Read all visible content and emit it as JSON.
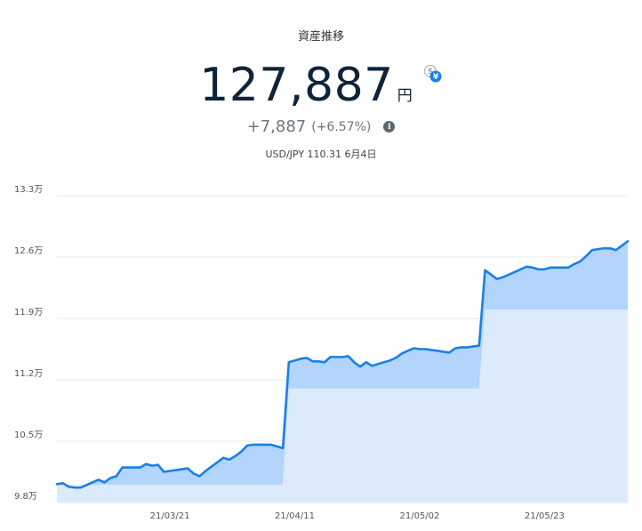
{
  "header": {
    "title": "資産推移",
    "total_value": "127,887",
    "unit": "円",
    "change_abs": "+7,887",
    "change_pct": "(+6.57%)",
    "fx_rate": "USD/JPY 110.31 6月4日"
  },
  "icons": {
    "currency_toggle": "dollar-yen-toggle-icon",
    "info": "info-icon"
  },
  "colors": {
    "line": "#1a7fe8",
    "area_top": "#b3d5fb",
    "area_base": "#dcebfb",
    "grid": "#e8e8e8"
  },
  "chart_data": {
    "type": "area",
    "title": "資産推移",
    "xlabel": "",
    "ylabel": "",
    "y_unit": "万",
    "ylim": [
      9.8,
      13.3
    ],
    "y_ticks": [
      "13.3万",
      "12.6万",
      "11.9万",
      "11.2万",
      "10.5万",
      "9.8万"
    ],
    "x_ticks": [
      "21/03/21",
      "21/04/11",
      "21/05/02",
      "21/05/23"
    ],
    "x_tick_positions": [
      19,
      40,
      61,
      82
    ],
    "grid": true,
    "legend": "none",
    "series": [
      {
        "role": "total",
        "x": [
          0,
          1,
          2,
          3,
          4,
          5,
          6,
          7,
          8,
          9,
          10,
          11,
          12,
          13,
          14,
          15,
          16,
          17,
          18,
          19,
          20,
          21,
          22,
          23,
          24,
          25,
          26,
          27,
          28,
          29,
          30,
          31,
          32,
          33,
          34,
          35,
          36,
          37,
          38,
          39,
          40,
          41,
          42,
          43,
          44,
          45,
          46,
          47,
          48,
          49,
          50,
          51,
          52,
          53,
          54,
          55,
          56,
          57,
          58,
          59,
          60,
          61,
          62,
          63,
          64,
          65,
          66,
          67,
          68,
          69,
          70,
          71,
          72,
          73,
          74,
          75,
          76,
          77,
          78,
          79,
          80,
          81,
          82,
          83,
          84,
          85,
          86,
          87,
          88,
          89,
          90,
          91,
          92,
          93,
          94,
          95,
          96
        ],
        "values": [
          10.01,
          10.02,
          9.98,
          9.97,
          9.97,
          10.0,
          10.03,
          10.06,
          10.03,
          10.08,
          10.1,
          10.2,
          10.2,
          10.2,
          10.2,
          10.24,
          10.22,
          10.23,
          10.15,
          10.16,
          10.17,
          10.18,
          10.19,
          10.13,
          10.1,
          10.16,
          10.21,
          10.26,
          10.31,
          10.29,
          10.33,
          10.38,
          10.45,
          10.46,
          10.46,
          10.46,
          10.46,
          10.44,
          10.42,
          11.4,
          11.42,
          11.44,
          11.45,
          11.41,
          11.41,
          11.4,
          11.46,
          11.46,
          11.46,
          11.47,
          11.4,
          11.35,
          11.4,
          11.36,
          11.38,
          11.4,
          11.42,
          11.45,
          11.5,
          11.53,
          11.56,
          11.55,
          11.55,
          11.54,
          11.53,
          11.52,
          11.51,
          11.56,
          11.57,
          11.57,
          11.58,
          11.59,
          12.45,
          12.4,
          12.35,
          12.37,
          12.4,
          12.43,
          12.46,
          12.49,
          12.48,
          12.46,
          12.46,
          12.48,
          12.48,
          12.48,
          12.48,
          12.52,
          12.55,
          12.61,
          12.68,
          12.69,
          12.7,
          12.7,
          12.68,
          12.73,
          12.78
        ]
      },
      {
        "role": "invested",
        "x": [
          0,
          10,
          10,
          38,
          39,
          71,
          72,
          96
        ],
        "values": [
          10.0,
          10.0,
          10.0,
          10.0,
          11.1,
          11.1,
          12.0,
          12.0
        ]
      }
    ]
  }
}
